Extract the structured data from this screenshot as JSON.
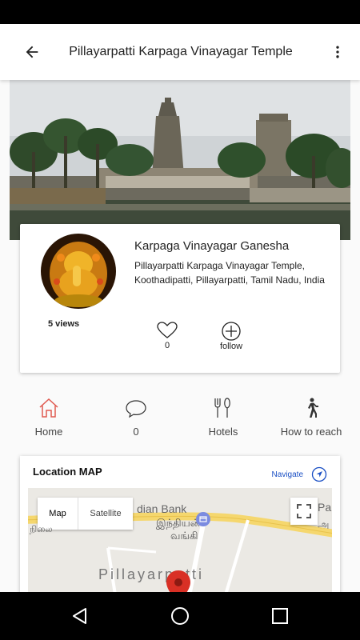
{
  "app_bar": {
    "title": "Pillayarpatti Karpaga Vinayagar Temple"
  },
  "card": {
    "deity_name": "Karpaga Vinayagar Ganesha",
    "address": "Pillayarpatti Karpaga Vinayagar Temple, Koothadipatti, Pillayarpatti, Tamil Nadu, India",
    "views": "5 views",
    "like_count": "0",
    "follow_label": "follow"
  },
  "nav": {
    "home": "Home",
    "comments": "0",
    "hotels": "Hotels",
    "reach": "How to reach"
  },
  "map": {
    "title": "Location MAP",
    "navigate": "Navigate",
    "toggle_map": "Map",
    "toggle_satellite": "Satellite",
    "bank_en": "dian Bank",
    "bank_ta": "இந்தியன்",
    "bank_ta2": "வங்கி",
    "left_ta": "நிலை",
    "place": "Pillayarpatti",
    "right_en": "Pa",
    "right_ta": "அ"
  },
  "colors": {
    "accent": "#e05a50",
    "link": "#1a4fc4",
    "pin": "#d93025"
  }
}
